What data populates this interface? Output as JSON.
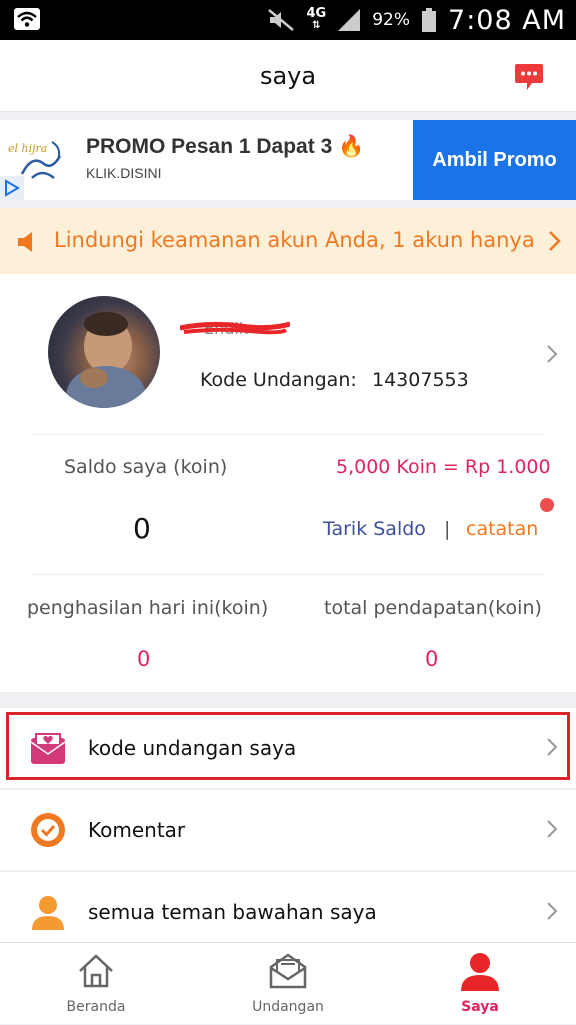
{
  "status_bar": {
    "network": "4G",
    "battery": "92%",
    "time": "7:08 AM"
  },
  "header": {
    "title": "saya"
  },
  "ad": {
    "logo_text": "el hijra",
    "title": "PROMO Pesan 1 Dapat 3 🔥",
    "subtitle": "KLIK.DISINI",
    "button": "Ambil Promo"
  },
  "notice": {
    "text": "Lindungi keamanan akun Anda, 1 akun hanya"
  },
  "profile": {
    "kode_label": "Kode Undangan:",
    "kode_value": "14307553"
  },
  "balance": {
    "label": "Saldo saya (koin)",
    "rate": "5,000 Koin = Rp 1.000",
    "value": "0",
    "withdraw": "Tarik Saldo",
    "separator": "|",
    "records": "catatan"
  },
  "earnings": {
    "today_label": "penghasilan hari ini(koin)",
    "today_value": "0",
    "total_label": "total pendapatan(koin)",
    "total_value": "0"
  },
  "menu": [
    {
      "label": "kode undangan saya",
      "icon": "envelope-heart-icon"
    },
    {
      "label": "Komentar",
      "icon": "check-circle-icon"
    },
    {
      "label": "semua teman bawahan saya",
      "icon": "person-icon"
    }
  ],
  "tabs": [
    {
      "label": "Beranda",
      "icon": "home-icon"
    },
    {
      "label": "Undangan",
      "icon": "mail-icon"
    },
    {
      "label": "Saya",
      "icon": "person-icon"
    }
  ],
  "colors": {
    "accent": "#e0245e",
    "orange": "#f07820",
    "ad_button": "#1a73e8",
    "highlight": "#d9252a"
  }
}
